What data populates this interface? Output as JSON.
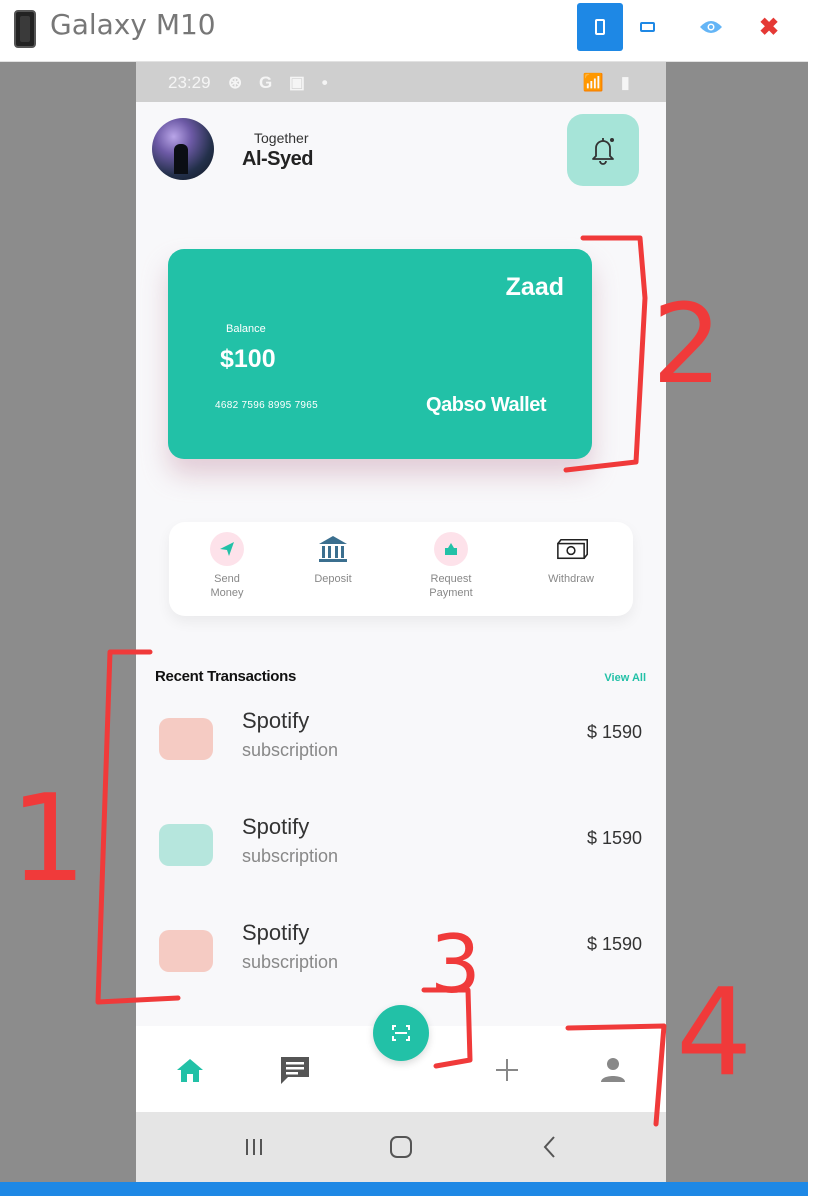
{
  "window": {
    "title": "Galaxy M10"
  },
  "statusbar": {
    "time": "23:29",
    "left_icons": "⊛ G ▣ •",
    "right_icons": "📶 ▮"
  },
  "header": {
    "greeting": "Together",
    "user_name": "Al-Syed"
  },
  "card": {
    "brand": "Zaad",
    "balance_label": "Balance",
    "balance_value": "$100",
    "card_number": "4682 7596 8995 7965",
    "wallet_name": "Qabso Wallet",
    "accent_color": "#22c1a7"
  },
  "quick_actions": [
    {
      "label": "Send\nMoney",
      "icon": "send-icon"
    },
    {
      "label": "Deposit",
      "icon": "bank-icon"
    },
    {
      "label": "Request\nPayment",
      "icon": "request-icon"
    },
    {
      "label": "Withdraw",
      "icon": "cash-icon"
    }
  ],
  "transactions": {
    "title": "Recent Transactions",
    "view_all": "View All",
    "items": [
      {
        "name": "Spotify",
        "sub": "subscription",
        "amount": "$ 1590",
        "color": "#f5cbc3"
      },
      {
        "name": "Spotify",
        "sub": "subscription",
        "amount": "$ 1590",
        "color": "#b6e6dd"
      },
      {
        "name": "Spotify",
        "sub": "subscription",
        "amount": "$ 1590",
        "color": "#f5cbc3"
      }
    ]
  },
  "annotations": [
    "1",
    "2",
    "3",
    "4"
  ]
}
